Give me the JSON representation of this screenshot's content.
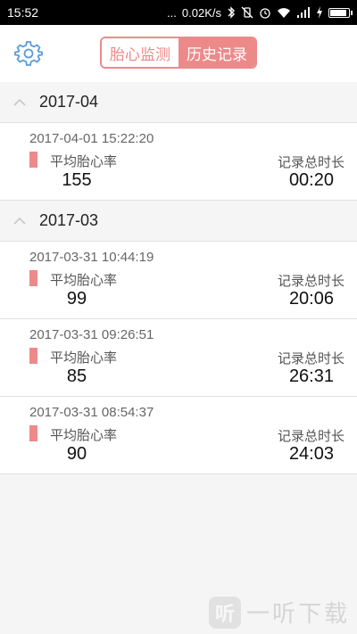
{
  "status_bar": {
    "time": "15:52",
    "dots": "...",
    "speed": "0.02K/s"
  },
  "header": {
    "tabs": [
      {
        "label": "胎心监测",
        "active": false
      },
      {
        "label": "历史记录",
        "active": true
      }
    ]
  },
  "groups": [
    {
      "month": "2017-04",
      "records": [
        {
          "datetime": "2017-04-01 15:22:20",
          "avg_label": "平均胎心率",
          "avg_value": "155",
          "duration_label": "记录总时长",
          "duration": "00:20"
        }
      ]
    },
    {
      "month": "2017-03",
      "records": [
        {
          "datetime": "2017-03-31 10:44:19",
          "avg_label": "平均胎心率",
          "avg_value": "99",
          "duration_label": "记录总时长",
          "duration": "20:06"
        },
        {
          "datetime": "2017-03-31 09:26:51",
          "avg_label": "平均胎心率",
          "avg_value": "85",
          "duration_label": "记录总时长",
          "duration": "26:31"
        },
        {
          "datetime": "2017-03-31 08:54:37",
          "avg_label": "平均胎心率",
          "avg_value": "90",
          "duration_label": "记录总时长",
          "duration": "24:03"
        }
      ]
    }
  ],
  "watermark": {
    "logo_text": "听",
    "text": "一听下载"
  },
  "colors": {
    "accent": "#ec8a8a",
    "settings_icon": "#5b9bd5"
  }
}
